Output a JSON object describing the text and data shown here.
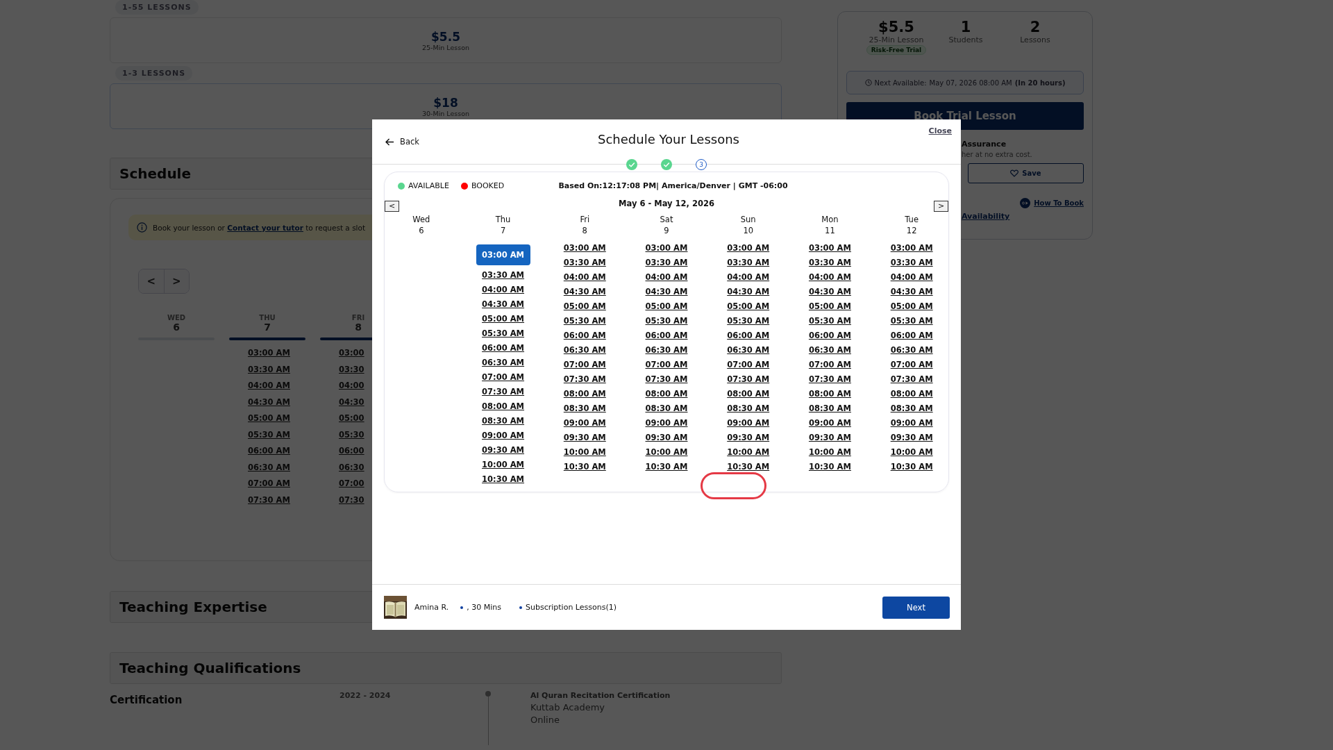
{
  "pricing": [
    {
      "tag": "1-55 LESSONS",
      "price": "$5.5",
      "unit": "25-Min Lesson"
    },
    {
      "tag": "1-3 LESSONS",
      "price": "$18",
      "unit": "30-Min Lesson"
    }
  ],
  "schedule_section": {
    "title": "Schedule",
    "notice": {
      "before": "Book your lesson or ",
      "link": "Contact your tutor",
      "after": " to request a slot"
    },
    "nav": [
      "<",
      ">"
    ],
    "days": [
      {
        "weekday": "WED",
        "date": "6",
        "available": false
      },
      {
        "weekday": "THU",
        "date": "7",
        "available": true,
        "slots": [
          "03:00 AM",
          "03:30 AM",
          "04:00 AM",
          "04:30 AM",
          "05:00 AM",
          "05:30 AM",
          "06:00 AM",
          "06:30 AM",
          "07:00 AM",
          "07:30 AM"
        ]
      },
      {
        "weekday": "FRI",
        "date": "8",
        "available": true,
        "slots": [
          "03:00",
          "03:30",
          "04:00",
          "04:30",
          "05:00",
          "05:30",
          "06:00",
          "06:30",
          "07:00",
          "07:30"
        ]
      }
    ]
  },
  "sections": [
    "Teaching Expertise",
    "Teaching Qualifications"
  ],
  "qualification": {
    "label": "Certification",
    "period": "2022 - 2024",
    "title": "Al Quran Recitation Certification",
    "institution": "Kuttab Academy",
    "mode": "Online"
  },
  "tutor_card": {
    "stats": [
      {
        "value": "$5.5",
        "label": "25-Min Lesson",
        "badge": "Risk-Free Trial"
      },
      {
        "value": "1",
        "label": "Students"
      },
      {
        "value": "2",
        "label": "Lessons"
      }
    ],
    "next_available": {
      "label": "Next Available:",
      "date": "May 07, 2026 08:00 AM",
      "relative": "(In 20 hours)"
    },
    "book_button": "Book Trial Lesson",
    "guarantee_title": "Assurance",
    "guarantee_text": "her at no extra cost.",
    "save_button": "Save",
    "how_to_book": "How To Book",
    "availability_link": "Availability"
  },
  "modal": {
    "back": "Back",
    "title": "Schedule Your Lessons",
    "close": "Close",
    "steps": [
      {
        "done": true
      },
      {
        "done": true
      },
      {
        "done": false,
        "number": "3"
      }
    ],
    "calendar": {
      "legend": [
        {
          "label": "AVAILABLE",
          "color": "#5ad68f"
        },
        {
          "label": "BOOKED",
          "color": "#ff0000"
        }
      ],
      "timezone": "Based On:12:17:08 PM| America/Denver | GMT -06:00",
      "prev": "<",
      "next": ">",
      "range": "May 6 - May 12, 2026",
      "days": [
        {
          "weekday": "Wed",
          "date": "6"
        },
        {
          "weekday": "Thu",
          "date": "7",
          "slots": [
            {
              "time": "03:00 AM",
              "selected": true
            },
            {
              "time": "03:30 AM",
              "selected": false
            },
            {
              "time": "04:00 AM",
              "selected": false
            },
            {
              "time": "04:30 AM",
              "selected": false
            },
            {
              "time": "05:00 AM",
              "selected": false
            },
            {
              "time": "05:30 AM",
              "selected": false
            },
            {
              "time": "06:00 AM",
              "selected": false
            },
            {
              "time": "06:30 AM",
              "selected": false
            },
            {
              "time": "07:00 AM",
              "selected": false
            },
            {
              "time": "07:30 AM",
              "selected": false
            },
            {
              "time": "08:00 AM",
              "selected": false
            },
            {
              "time": "08:30 AM",
              "selected": false
            },
            {
              "time": "09:00 AM",
              "selected": false
            },
            {
              "time": "09:30 AM",
              "selected": false
            },
            {
              "time": "10:00 AM",
              "selected": false
            },
            {
              "time": "10:30 AM",
              "selected": false
            }
          ]
        },
        {
          "weekday": "Fri",
          "date": "8",
          "slots": [
            {
              "time": "03:00 AM",
              "selected": false
            },
            {
              "time": "03:30 AM",
              "selected": false
            },
            {
              "time": "04:00 AM",
              "selected": false
            },
            {
              "time": "04:30 AM",
              "selected": false
            },
            {
              "time": "05:00 AM",
              "selected": false
            },
            {
              "time": "05:30 AM",
              "selected": false
            },
            {
              "time": "06:00 AM",
              "selected": false
            },
            {
              "time": "06:30 AM",
              "selected": false
            },
            {
              "time": "07:00 AM",
              "selected": false
            },
            {
              "time": "07:30 AM",
              "selected": false
            },
            {
              "time": "08:00 AM",
              "selected": false
            },
            {
              "time": "08:30 AM",
              "selected": false
            },
            {
              "time": "09:00 AM",
              "selected": false
            },
            {
              "time": "09:30 AM",
              "selected": false
            },
            {
              "time": "10:00 AM",
              "selected": false
            },
            {
              "time": "10:30 AM",
              "selected": false
            }
          ]
        },
        {
          "weekday": "Sat",
          "date": "9",
          "slots": [
            {
              "time": "03:00 AM",
              "selected": false
            },
            {
              "time": "03:30 AM",
              "selected": false
            },
            {
              "time": "04:00 AM",
              "selected": false
            },
            {
              "time": "04:30 AM",
              "selected": false
            },
            {
              "time": "05:00 AM",
              "selected": false
            },
            {
              "time": "05:30 AM",
              "selected": false
            },
            {
              "time": "06:00 AM",
              "selected": false
            },
            {
              "time": "06:30 AM",
              "selected": false
            },
            {
              "time": "07:00 AM",
              "selected": false
            },
            {
              "time": "07:30 AM",
              "selected": false
            },
            {
              "time": "08:00 AM",
              "selected": false
            },
            {
              "time": "08:30 AM",
              "selected": false
            },
            {
              "time": "09:00 AM",
              "selected": false
            },
            {
              "time": "09:30 AM",
              "selected": false
            },
            {
              "time": "10:00 AM",
              "selected": false
            },
            {
              "time": "10:30 AM",
              "selected": false
            }
          ]
        },
        {
          "weekday": "Sun",
          "date": "10",
          "slots": [
            {
              "time": "03:00 AM",
              "selected": false
            },
            {
              "time": "03:30 AM",
              "selected": false
            },
            {
              "time": "04:00 AM",
              "selected": false
            },
            {
              "time": "04:30 AM",
              "selected": false
            },
            {
              "time": "05:00 AM",
              "selected": false
            },
            {
              "time": "05:30 AM",
              "selected": false
            },
            {
              "time": "06:00 AM",
              "selected": false
            },
            {
              "time": "06:30 AM",
              "selected": false
            },
            {
              "time": "07:00 AM",
              "selected": false
            },
            {
              "time": "07:30 AM",
              "selected": false
            },
            {
              "time": "08:00 AM",
              "selected": false
            },
            {
              "time": "08:30 AM",
              "selected": false
            },
            {
              "time": "09:00 AM",
              "selected": false
            },
            {
              "time": "09:30 AM",
              "selected": false
            },
            {
              "time": "10:00 AM",
              "selected": false
            },
            {
              "time": "10:30 AM",
              "selected": false
            }
          ]
        },
        {
          "weekday": "Mon",
          "date": "11",
          "slots": [
            {
              "time": "03:00 AM",
              "selected": false
            },
            {
              "time": "03:30 AM",
              "selected": false
            },
            {
              "time": "04:00 AM",
              "selected": false
            },
            {
              "time": "04:30 AM",
              "selected": false
            },
            {
              "time": "05:00 AM",
              "selected": false
            },
            {
              "time": "05:30 AM",
              "selected": false
            },
            {
              "time": "06:00 AM",
              "selected": false
            },
            {
              "time": "06:30 AM",
              "selected": false
            },
            {
              "time": "07:00 AM",
              "selected": false
            },
            {
              "time": "07:30 AM",
              "selected": false
            },
            {
              "time": "08:00 AM",
              "selected": false
            },
            {
              "time": "08:30 AM",
              "selected": false
            },
            {
              "time": "09:00 AM",
              "selected": false
            },
            {
              "time": "09:30 AM",
              "selected": false
            },
            {
              "time": "10:00 AM",
              "selected": false
            },
            {
              "time": "10:30 AM",
              "selected": false
            }
          ]
        },
        {
          "weekday": "Tue",
          "date": "12",
          "slots": [
            {
              "time": "03:00 AM",
              "selected": false
            },
            {
              "time": "03:30 AM",
              "selected": false
            },
            {
              "time": "04:00 AM",
              "selected": false
            },
            {
              "time": "04:30 AM",
              "selected": false
            },
            {
              "time": "05:00 AM",
              "selected": false
            },
            {
              "time": "05:30 AM",
              "selected": false
            },
            {
              "time": "06:00 AM",
              "selected": false
            },
            {
              "time": "06:30 AM",
              "selected": false
            },
            {
              "time": "07:00 AM",
              "selected": false
            },
            {
              "time": "07:30 AM",
              "selected": false
            },
            {
              "time": "08:00 AM",
              "selected": false
            },
            {
              "time": "08:30 AM",
              "selected": false
            },
            {
              "time": "09:00 AM",
              "selected": false
            },
            {
              "time": "09:30 AM",
              "selected": false
            },
            {
              "time": "10:00 AM",
              "selected": false
            },
            {
              "time": "10:30 AM",
              "selected": false
            }
          ]
        }
      ]
    },
    "footer": {
      "tutor": "Amina R.",
      "duration": ", 30 Mins",
      "plan": "Subscription Lessons(1)",
      "next": "Next"
    }
  }
}
